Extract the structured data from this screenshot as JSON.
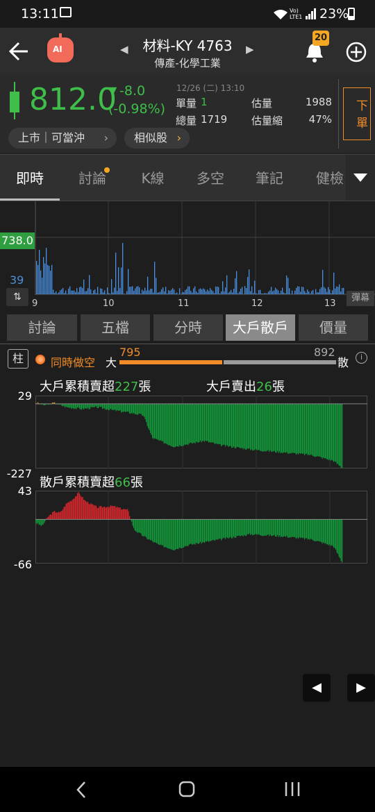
{
  "status_bar": {
    "time": "13:11",
    "network": "Vo) LTE1",
    "battery": "23%"
  },
  "header": {
    "title": "材料-KY 4763",
    "subtitle": "傳產-化學工業",
    "ai_badge": "AI",
    "notification_count": "20"
  },
  "quote": {
    "price": "812.0",
    "change": "-8.0",
    "change_pct": "(-0.98%)",
    "datetime": "12/26 (二) 13:10",
    "single_volume_label": "單量",
    "single_volume": "1",
    "total_volume_label": "總量",
    "total_volume": "1719",
    "est_volume_label": "估量",
    "est_volume": "1988",
    "est_ratio_label": "估量縮",
    "est_ratio": "47%",
    "order_button": "下單",
    "market_pill": "上市｜可當沖",
    "similar_pill": "相似股",
    "colors": {
      "down": "#3fbf4a",
      "up": "#e53935",
      "accent": "#f28c28"
    }
  },
  "tabs": [
    "即時",
    "討論",
    "K線",
    "多空",
    "筆記",
    "健檢"
  ],
  "tick_chart": {
    "price_tag": "738.0",
    "volume_tag": "39",
    "danmaku_label": "彈幕",
    "x_labels": [
      "9",
      "10",
      "11",
      "12",
      "13"
    ]
  },
  "subtabs": [
    "討論",
    "五檔",
    "分時",
    "大戶散戶",
    "價量"
  ],
  "main": {
    "column_button": "柱",
    "toggle_label": "同時做空",
    "big_label": "大",
    "big_value": "795",
    "small_value": "892",
    "small_label": "散",
    "info_icon": "info-icon"
  },
  "chart_data": [
    {
      "type": "bar",
      "title_prefix": "大戶累積賣超",
      "title_value": "227",
      "title_unit": "張",
      "side_prefix": "大戶賣出",
      "side_value": "26",
      "side_unit": "張",
      "y_max_label": "29",
      "y_min_label": "-227",
      "ylim": [
        -227,
        29
      ],
      "x_range": [
        "9:00",
        "13:10"
      ],
      "series_shape": [
        [
          0,
          4
        ],
        [
          0.03,
          -5
        ],
        [
          0.06,
          3
        ],
        [
          0.1,
          -12
        ],
        [
          0.15,
          -18
        ],
        [
          0.2,
          -12
        ],
        [
          0.25,
          -22
        ],
        [
          0.3,
          -30
        ],
        [
          0.35,
          -40
        ],
        [
          0.38,
          -120
        ],
        [
          0.45,
          -150
        ],
        [
          0.55,
          -130
        ],
        [
          0.6,
          -145
        ],
        [
          0.7,
          -160
        ],
        [
          0.8,
          -170
        ],
        [
          0.9,
          -180
        ],
        [
          0.97,
          -200
        ],
        [
          1.0,
          -227
        ]
      ],
      "colors": {
        "positive": "#f0a020",
        "negative": "#139a3a"
      }
    },
    {
      "type": "bar",
      "title_prefix": "散戶累積賣超",
      "title_value": "66",
      "title_unit": "張",
      "y_max_label": "43",
      "y_min_label": "-66",
      "ylim": [
        -66,
        43
      ],
      "x_range": [
        "9:00",
        "13:10"
      ],
      "series_shape": [
        [
          0,
          -5
        ],
        [
          0.02,
          -10
        ],
        [
          0.04,
          4
        ],
        [
          0.06,
          12
        ],
        [
          0.08,
          10
        ],
        [
          0.1,
          24
        ],
        [
          0.12,
          30
        ],
        [
          0.14,
          40
        ],
        [
          0.16,
          28
        ],
        [
          0.2,
          18
        ],
        [
          0.25,
          20
        ],
        [
          0.28,
          16
        ],
        [
          0.3,
          14
        ],
        [
          0.32,
          -15
        ],
        [
          0.35,
          -25
        ],
        [
          0.4,
          -38
        ],
        [
          0.45,
          -45
        ],
        [
          0.5,
          -38
        ],
        [
          0.6,
          -30
        ],
        [
          0.7,
          -22
        ],
        [
          0.8,
          -25
        ],
        [
          0.9,
          -30
        ],
        [
          0.97,
          -40
        ],
        [
          1.0,
          -66
        ]
      ],
      "colors": {
        "positive": "#d8262c",
        "negative": "#139a3a"
      }
    }
  ],
  "pager": {
    "prev": "◀",
    "next": "▶"
  }
}
